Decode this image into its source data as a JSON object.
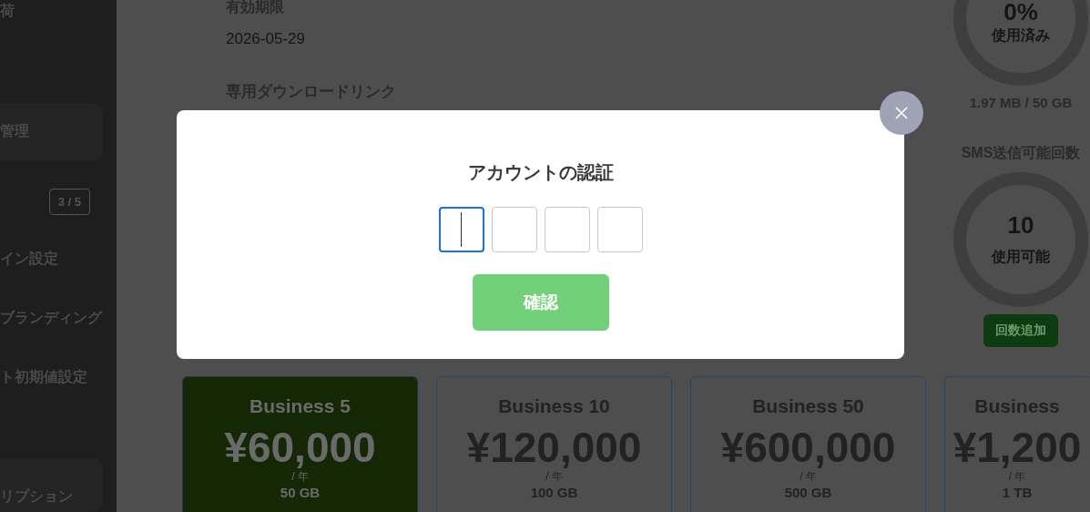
{
  "sidebar": {
    "items": [
      {
        "kind": "text",
        "label": "荷"
      },
      {
        "kind": "panel",
        "label": "管理"
      },
      {
        "kind": "badge",
        "label": "3 / 5"
      },
      {
        "kind": "text",
        "label": "イン設定"
      },
      {
        "kind": "text",
        "label": "ブランディング"
      },
      {
        "kind": "text",
        "label": "ト初期値設定"
      },
      {
        "kind": "panel",
        "label": "リプション"
      }
    ]
  },
  "info": {
    "expiry_label": "有効期限",
    "expiry_date": "2026-05-29",
    "download_heading": "専用ダウンロードリンク"
  },
  "storage": {
    "percent": "0%",
    "caption": "使用済み",
    "usage": "1.97 MB / 50 GB"
  },
  "sms": {
    "heading": "SMS送信可能回数",
    "count": "10",
    "caption": "使用可能",
    "button": "回数追加"
  },
  "plans": [
    {
      "name": "Business 5",
      "price": "¥60,000",
      "period": "/ 年",
      "storage": "50 GB",
      "selected": true
    },
    {
      "name": "Business 10",
      "price": "¥120,000",
      "period": "/ 年",
      "storage": "100 GB",
      "selected": false
    },
    {
      "name": "Business 50",
      "price": "¥600,000",
      "period": "/ 年",
      "storage": "500 GB",
      "selected": false
    },
    {
      "name": "Business",
      "price": "¥1,200",
      "period": "/ 年",
      "storage": "1 TB",
      "selected": false
    }
  ],
  "dialog": {
    "title": "アカウントの認証",
    "code_inputs": [
      {
        "focused": true
      },
      {
        "focused": false
      },
      {
        "focused": false
      },
      {
        "focused": false
      }
    ],
    "confirm_button": "確認"
  }
}
